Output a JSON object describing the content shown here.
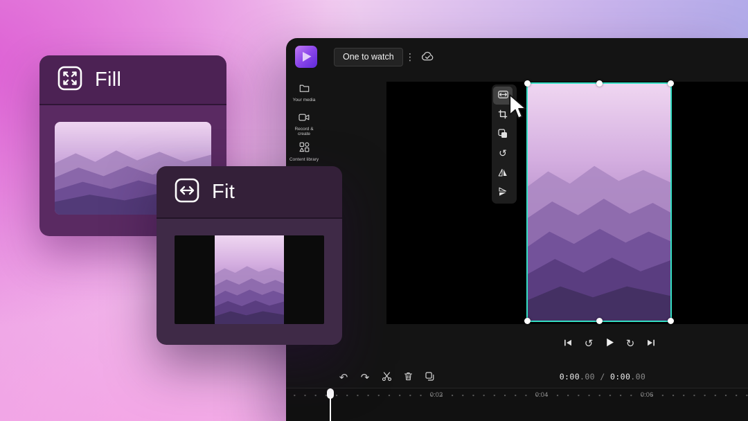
{
  "cards": {
    "fill": {
      "label": "Fill",
      "icon": "expand-arrows-icon"
    },
    "fit": {
      "label": "Fit",
      "icon": "fit-width-arrows-icon"
    }
  },
  "editor": {
    "topbar": {
      "project_name": "One to watch"
    },
    "sidebar": {
      "items": [
        {
          "icon": "folder-icon",
          "label": "Your media"
        },
        {
          "icon": "camera-icon",
          "label": "Record & create"
        },
        {
          "icon": "shapes-icon",
          "label": "Content library"
        }
      ]
    },
    "clip_toolbar": [
      "fit-button",
      "crop-button",
      "overlay-button",
      "rotate-button",
      "flip-horizontal-button",
      "flip-vertical-button"
    ],
    "transport": [
      "skip-start-button",
      "rewind-1s-button",
      "play-button",
      "forward-1s-button",
      "skip-end-button"
    ],
    "edit_tools": [
      "undo-button",
      "redo-button",
      "split-button",
      "delete-button",
      "duplicate-button"
    ],
    "time": {
      "current": "0:00",
      "current_frac": ".00",
      "separator": "/",
      "total": "0:00",
      "total_frac": ".00"
    },
    "timeline": {
      "labels": [
        "0:02",
        "0:04",
        "0:06"
      ]
    }
  },
  "icons": {
    "more_glyph": "⋮",
    "rotate_glyph": "↺",
    "rewind_glyph": "↺",
    "forward_glyph": "↻",
    "undo_glyph": "↶",
    "redo_glyph": "↷"
  },
  "colors": {
    "selection_accent": "#35e0c4",
    "editor_bg": "#141414",
    "fill_card": "#5a2a62",
    "fit_card": "#3f2a47",
    "bg_left": "#dd5fd4",
    "bg_right": "#a7a6e7"
  }
}
